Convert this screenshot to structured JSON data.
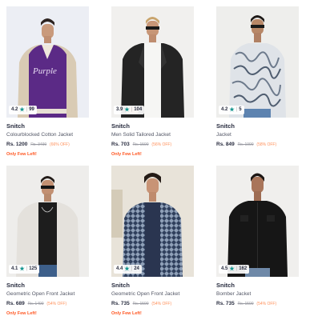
{
  "products": [
    {
      "brand": "Snitch",
      "name": "Colourblocked Cotton Jacket",
      "price": "Rs. 1200",
      "mrp": "Rs. 3499",
      "discount": "(66% OFF)",
      "urgency": "Only Few Left!",
      "rating": "4.2",
      "rating_count": "99",
      "image_alt": "model-in-purple-varsity-jacket"
    },
    {
      "brand": "Snitch",
      "name": "Men Solid Tailored Jacket",
      "price": "Rs. 703",
      "mrp": "Rs. 1599",
      "discount": "(56% OFF)",
      "urgency": "Only Few Left!",
      "rating": "3.9",
      "rating_count": "104",
      "image_alt": "model-in-black-jacket"
    },
    {
      "brand": "Snitch",
      "name": "Jacket",
      "price": "Rs. 849",
      "mrp": "Rs. 1999",
      "discount": "(58% OFF)",
      "urgency": "",
      "rating": "4.2",
      "rating_count": "5",
      "image_alt": "model-in-printed-shirt-jacket"
    },
    {
      "brand": "Snitch",
      "name": "Geometric Open Front Jacket",
      "price": "Rs. 689",
      "mrp": "Rs. 1499",
      "discount": "(54% OFF)",
      "urgency": "Only Few Left!",
      "rating": "4.1",
      "rating_count": "125",
      "image_alt": "model-in-white-overshirt"
    },
    {
      "brand": "Snitch",
      "name": "Geometric Open Front Jacket",
      "price": "Rs. 735",
      "mrp": "Rs. 1599",
      "discount": "(54% OFF)",
      "urgency": "Only Few Left!",
      "rating": "4.4",
      "rating_count": "24",
      "image_alt": "model-in-geometric-print-jacket"
    },
    {
      "brand": "Snitch",
      "name": "Bomber Jacket",
      "price": "Rs. 735",
      "mrp": "Rs. 1599",
      "discount": "(54% OFF)",
      "urgency": "",
      "rating": "4.5",
      "rating_count": "162",
      "image_alt": "model-in-black-bomber-jacket"
    }
  ],
  "colors": {
    "rating_star": "#14958f",
    "discount": "#ff905a",
    "urgency": "#ff5722"
  }
}
